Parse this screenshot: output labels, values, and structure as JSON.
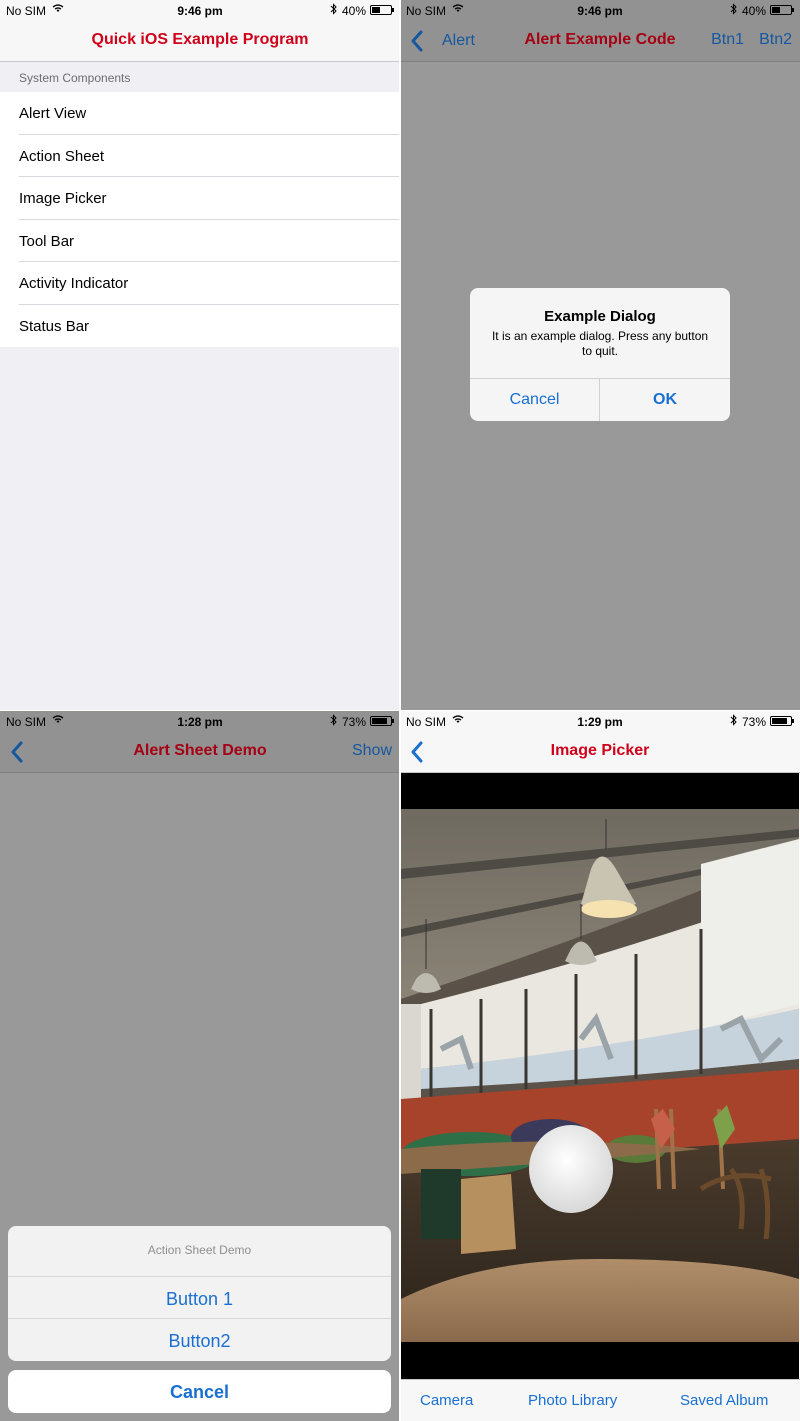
{
  "status_top": {
    "carrier": "No SIM",
    "time": "9:46 pm",
    "battery": "40%",
    "battery_level": 0.4
  },
  "status_bottom_left": {
    "carrier": "No SIM",
    "time": "1:28 pm",
    "battery": "73%",
    "battery_level": 0.73
  },
  "status_bottom_right": {
    "carrier": "No SIM",
    "time": "1:29 pm",
    "battery": "73%",
    "battery_level": 0.73
  },
  "menu_screen": {
    "title": "Quick iOS Example Program",
    "section_header": "System Components",
    "items": [
      "Alert View",
      "Action Sheet",
      "Image Picker",
      "Tool Bar",
      "Activity Indicator",
      "Status Bar"
    ]
  },
  "alert_screen": {
    "back_label": "Alert",
    "title": "Alert Example Code",
    "right_buttons": [
      "Btn1",
      "Btn2"
    ],
    "dialog": {
      "title": "Example Dialog",
      "message": "It is an example dialog. Press any button to quit.",
      "cancel": "Cancel",
      "ok": "OK"
    }
  },
  "sheet_screen": {
    "title": "Alert Sheet Demo",
    "right_button": "Show",
    "sheet": {
      "title": "Action Sheet Demo",
      "buttons": [
        "Button 1",
        "Button2"
      ],
      "cancel": "Cancel"
    }
  },
  "picker_screen": {
    "title": "Image Picker",
    "toolbar": [
      "Camera",
      "Photo Library",
      "Saved Album"
    ]
  },
  "colors": {
    "title_red": "#d0021b",
    "ios_blue": "#1a6fd2",
    "dim_gray": "#999999"
  }
}
